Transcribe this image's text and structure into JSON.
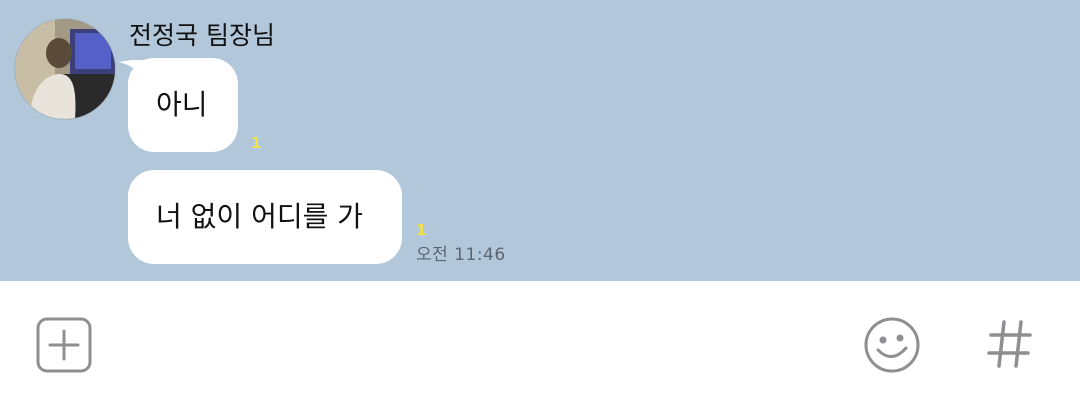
{
  "chat": {
    "sender_name": "전정국 팀장님",
    "messages": [
      {
        "text": "아니",
        "unread": "1"
      },
      {
        "text": "너 없이 어디를 가",
        "unread": "1",
        "time": "오전 11:46"
      }
    ]
  },
  "input_bar": {
    "icons": [
      "plus-icon",
      "emoji-icon",
      "hashtag-icon"
    ]
  },
  "colors": {
    "chat_background": "#b2c7da",
    "bubble": "#ffffff",
    "unread_count": "#f3e245",
    "icon_gray": "#8e8e93"
  }
}
